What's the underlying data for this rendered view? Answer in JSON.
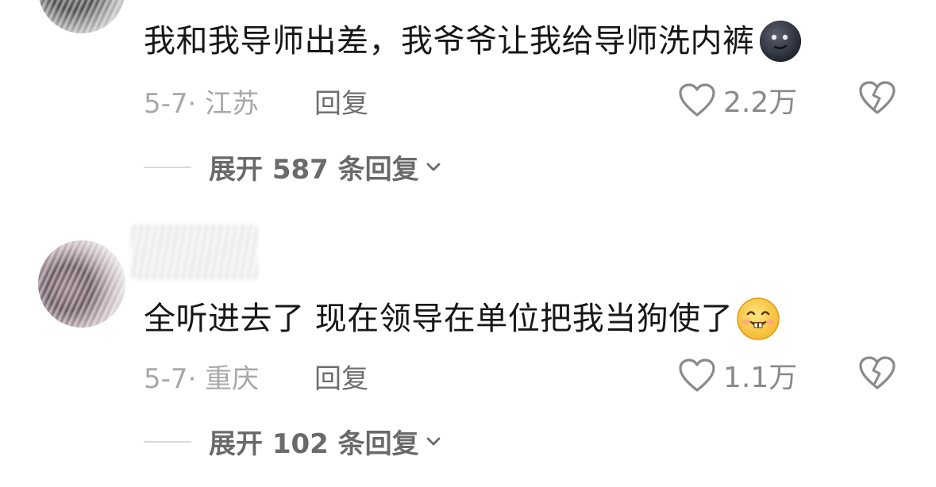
{
  "comments": [
    {
      "avatar_icon": "user-avatar-blurred",
      "text": "我和我导师出差，我爷爷让我给导师洗内裤",
      "emoji_icon": "dark-moon-face-emoji",
      "meta": "5-7· 江苏",
      "reply_label": "回复",
      "like_count": "2.2万",
      "expand_label": "展开 587 条回复"
    },
    {
      "avatar_icon": "user-avatar-blurred",
      "text": "全听进去了 现在领导在单位把我当狗使了",
      "emoji_icon": "buck-teeth-smile-emoji",
      "meta": "5-7· 重庆",
      "reply_label": "回复",
      "like_count": "1.1万",
      "expand_label": "展开 102 条回复"
    }
  ],
  "colors": {
    "text_primary": "#171717",
    "text_meta": "#a8a8a8",
    "text_secondary": "#6e6e6e",
    "icon_gray": "#8a8a8a"
  }
}
